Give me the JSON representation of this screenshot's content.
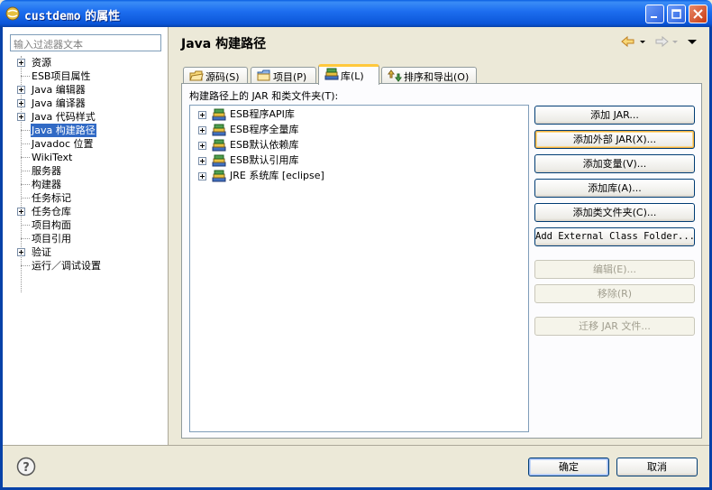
{
  "window": {
    "title_main": "custdemo",
    "title_suffix": " 的属性"
  },
  "filter": {
    "placeholder": "输入过滤器文本"
  },
  "tree": {
    "items": [
      {
        "label": "资源",
        "expandable": true,
        "selected": false
      },
      {
        "label": "ESB项目属性",
        "expandable": false,
        "selected": false
      },
      {
        "label": "Java 编辑器",
        "expandable": true,
        "selected": false
      },
      {
        "label": "Java 编译器",
        "expandable": true,
        "selected": false
      },
      {
        "label": "Java 代码样式",
        "expandable": true,
        "selected": false
      },
      {
        "label": "Java 构建路径",
        "expandable": false,
        "selected": true
      },
      {
        "label": "Javadoc 位置",
        "expandable": false,
        "selected": false
      },
      {
        "label": "WikiText",
        "expandable": false,
        "selected": false
      },
      {
        "label": "服务器",
        "expandable": false,
        "selected": false
      },
      {
        "label": "构建器",
        "expandable": false,
        "selected": false
      },
      {
        "label": "任务标记",
        "expandable": false,
        "selected": false
      },
      {
        "label": "任务仓库",
        "expandable": true,
        "selected": false
      },
      {
        "label": "项目构面",
        "expandable": false,
        "selected": false
      },
      {
        "label": "项目引用",
        "expandable": false,
        "selected": false
      },
      {
        "label": "验证",
        "expandable": true,
        "selected": false
      },
      {
        "label": "运行／调试设置",
        "expandable": false,
        "selected": false
      }
    ]
  },
  "page": {
    "title": "Java 构建路径"
  },
  "tabs": [
    {
      "label": "源码(S)",
      "icon": "source-folder-icon",
      "active": false
    },
    {
      "label": "项目(P)",
      "icon": "project-folder-icon",
      "active": false
    },
    {
      "label": "库(L)",
      "icon": "library-icon",
      "active": true
    },
    {
      "label": "排序和导出(O)",
      "icon": "order-export-icon",
      "active": false
    }
  ],
  "build_path_label": "构建路径上的 JAR 和类文件夹(T):",
  "libraries": [
    {
      "label": "ESB程序API库"
    },
    {
      "label": "ESB程序全量库"
    },
    {
      "label": "ESB默认依赖库"
    },
    {
      "label": "ESB默认引用库"
    },
    {
      "label": "JRE 系统库 [eclipse]"
    }
  ],
  "buttons": {
    "add_jar": "添加 JAR...",
    "add_external_jar": "添加外部 JAR(X)...",
    "add_variable": "添加变量(V)...",
    "add_library": "添加库(A)...",
    "add_class_folder": "添加类文件夹(C)...",
    "add_external_class_folder": "Add External Class Folder...",
    "edit": "编辑(E)...",
    "remove": "移除(R)",
    "migrate_jar": "迁移 JAR 文件..."
  },
  "footer": {
    "ok": "确定",
    "cancel": "取消"
  },
  "colors": {
    "selection": "#316ac5",
    "titlebar": "#0a55d8",
    "active_tab_accent": "#ffc83c"
  }
}
